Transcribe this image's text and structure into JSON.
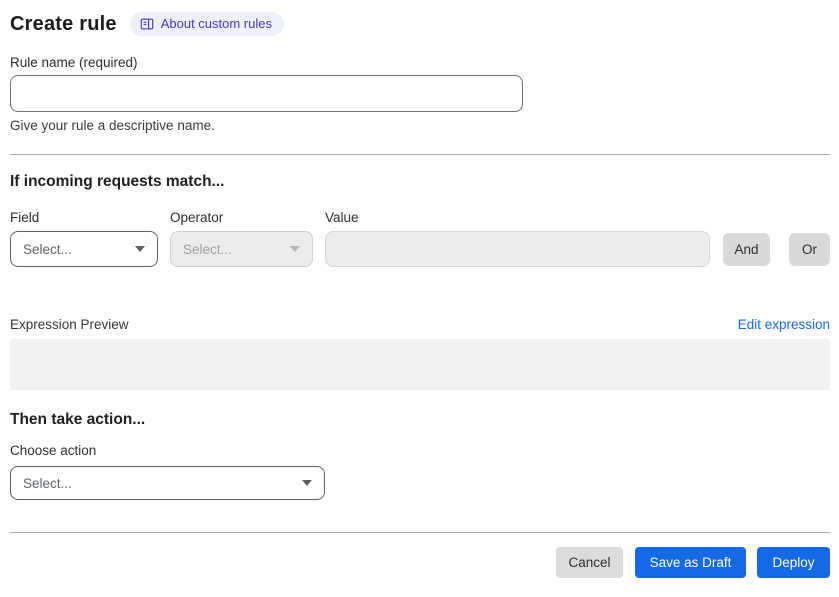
{
  "page": {
    "title": "Create rule",
    "about_badge": "About custom rules"
  },
  "rule_name": {
    "label": "Rule name (required)",
    "value": "",
    "helper": "Give your rule a descriptive name."
  },
  "match": {
    "heading": "If incoming requests match...",
    "field_label": "Field",
    "operator_label": "Operator",
    "value_label": "Value",
    "field_value": "Select...",
    "operator_value": "Select...",
    "value_value": "",
    "and_label": "And",
    "or_label": "Or",
    "preview_label": "Expression Preview",
    "edit_link": "Edit expression",
    "expression_value": ""
  },
  "action": {
    "heading": "Then take action...",
    "label": "Choose action",
    "value": "Select..."
  },
  "footer": {
    "cancel": "Cancel",
    "save_draft": "Save as Draft",
    "deploy": "Deploy"
  },
  "colors": {
    "primary_blue": "#1569e6",
    "link_blue": "#1569e6",
    "badge_bg": "#eef0fc",
    "badge_text": "#4338ca",
    "disabled_bg": "#ececec",
    "neutral_button_bg": "#d9d9d9"
  }
}
